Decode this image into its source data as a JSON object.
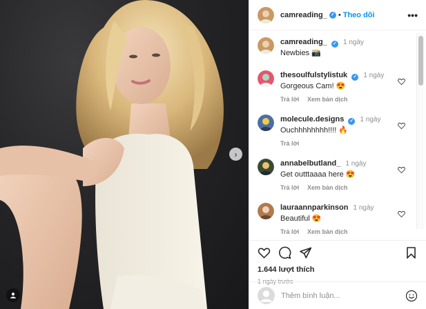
{
  "post": {
    "author": "camreading_",
    "separator": "•",
    "follow_label": "Theo dõi",
    "more_label": "•••",
    "next_icon": "chevron-right-icon"
  },
  "caption": {
    "user": "camreading_",
    "time": "1 ngày",
    "text": "Newbies 📸"
  },
  "comments": [
    {
      "user": "thesoulfulstylistuk",
      "time": "1 ngày",
      "text": "Gorgeous Cam! 😍",
      "reply": "Trả lời",
      "translate": "Xem bản dịch",
      "avatar_color": "#e5566d"
    },
    {
      "user": "molecule.designs",
      "time": "1 ngày",
      "text": "Ouchhhhhhhh!!!! 🔥",
      "reply": "Trả lời",
      "translate": "",
      "avatar_color": "#4a6fa5"
    },
    {
      "user": "annabelbutland_",
      "time": "1 ngày",
      "text": "Get outttaaaa here 😍",
      "reply": "Trả lời",
      "translate": "Xem bản dịch",
      "avatar_color": "#3b4a2e"
    },
    {
      "user": "lauraannparkinson",
      "time": "1 ngày",
      "text": "Beautiful 😍",
      "reply": "Trả lời",
      "translate": "Xem bản dịch",
      "avatar_color": "#b07a4e"
    }
  ],
  "engagement": {
    "likes": "1.644 lượt thích",
    "posted_ago": "1 ngày trước"
  },
  "composer": {
    "placeholder": "Thêm bình luận..."
  },
  "colors": {
    "accent": "#0095f6",
    "verified": "#3897f0",
    "text": "#262626",
    "muted": "#8e8e8e"
  }
}
